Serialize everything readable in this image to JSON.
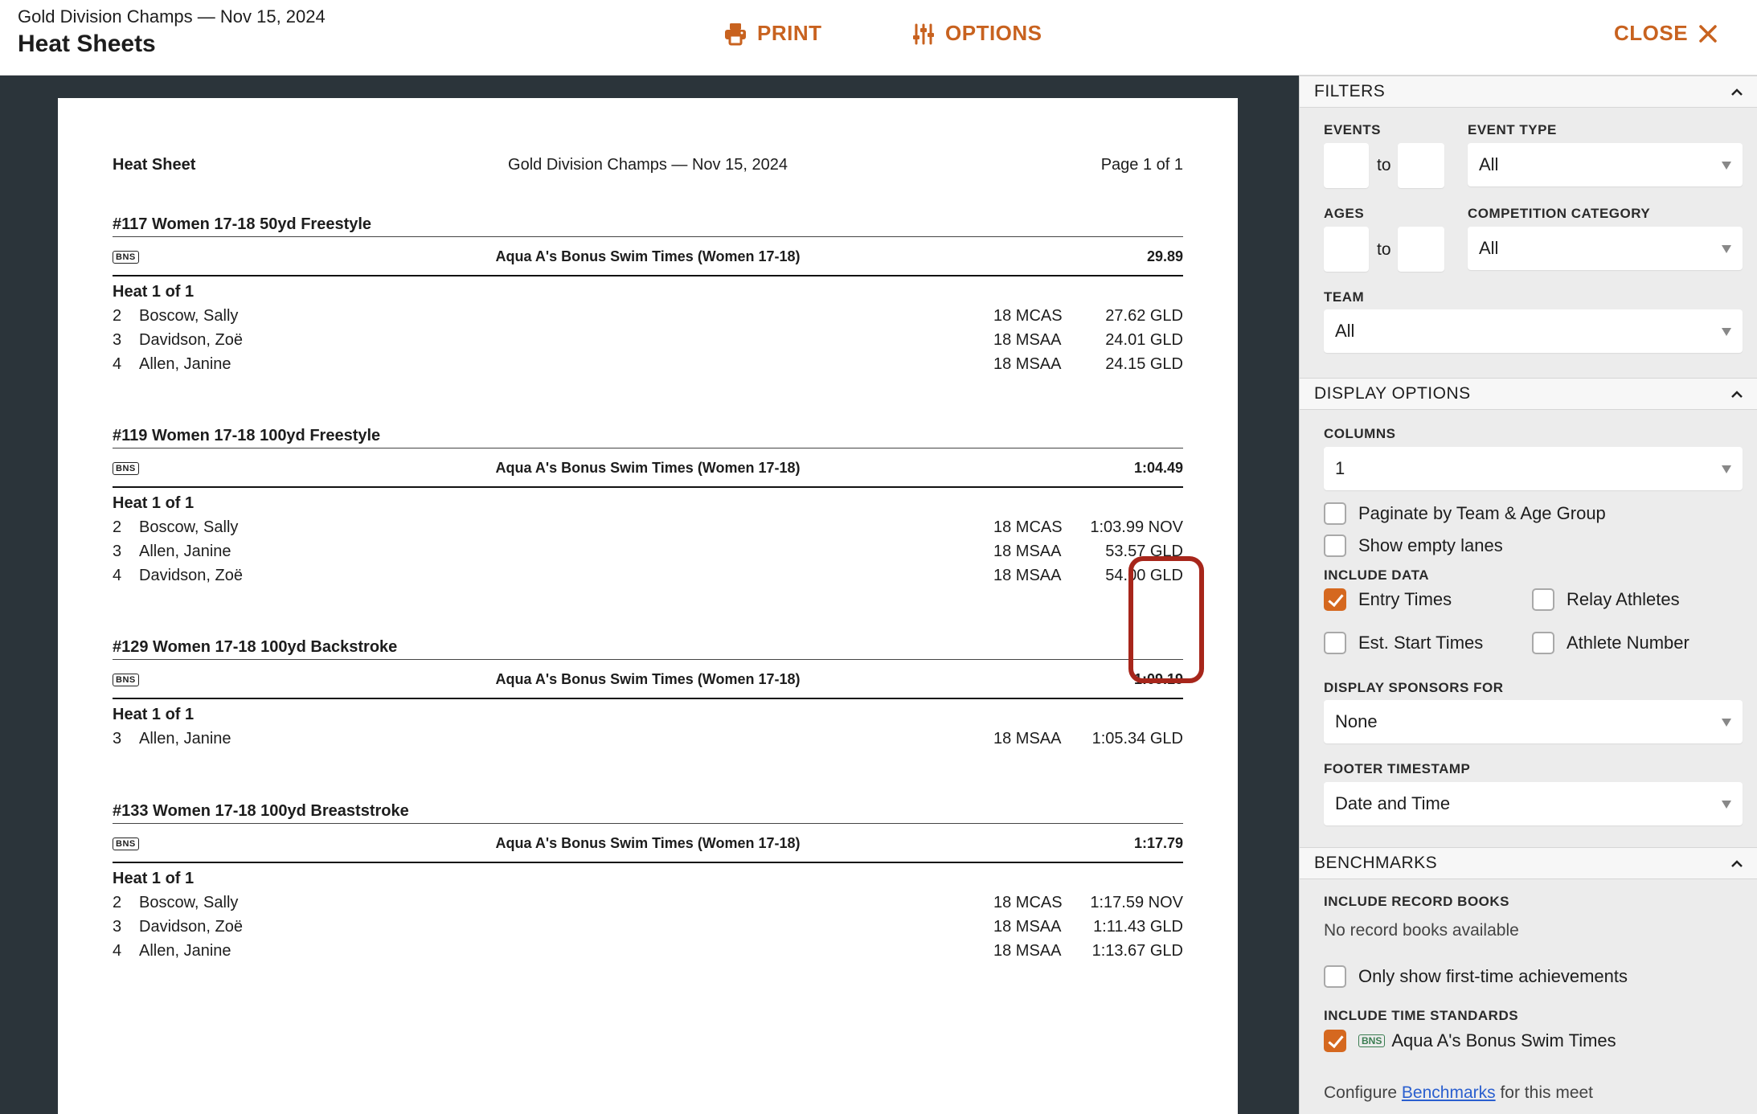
{
  "header": {
    "meet_name": "Gold Division Champs — Nov 15, 2024",
    "title": "Heat Sheets",
    "print_label": "PRINT",
    "options_label": "OPTIONS",
    "close_label": "CLOSE"
  },
  "doc": {
    "heading_left": "Heat Sheet",
    "heading_center": "Gold Division Champs — Nov 15, 2024",
    "heading_right": "Page 1 of 1",
    "events": [
      {
        "title": "#117 Women 17-18 50yd Freestyle",
        "badge": "BNS",
        "standard": "Aqua A's Bonus Swim Times (Women 17-18)",
        "standard_time": "29.89",
        "heat": "Heat 1 of 1",
        "rows": [
          {
            "lane": "2",
            "name": "Boscow, Sally",
            "team": "18 MCAS",
            "time": "27.62 GLD"
          },
          {
            "lane": "3",
            "name": "Davidson, Zoë",
            "team": "18 MSAA",
            "time": "24.01 GLD"
          },
          {
            "lane": "4",
            "name": "Allen, Janine",
            "team": "18 MSAA",
            "time": "24.15 GLD"
          }
        ]
      },
      {
        "title": "#119 Women 17-18 100yd Freestyle",
        "badge": "BNS",
        "standard": "Aqua A's Bonus Swim Times (Women 17-18)",
        "standard_time": "1:04.49",
        "heat": "Heat 1 of 1",
        "rows": [
          {
            "lane": "2",
            "name": "Boscow, Sally",
            "team": "18 MCAS",
            "time": "1:03.99 NOV"
          },
          {
            "lane": "3",
            "name": "Allen, Janine",
            "team": "18 MSAA",
            "time": "53.57 GLD"
          },
          {
            "lane": "4",
            "name": "Davidson, Zoë",
            "team": "18 MSAA",
            "time": "54.00 GLD"
          }
        ]
      },
      {
        "title": "#129 Women 17-18 100yd Backstroke",
        "badge": "BNS",
        "standard": "Aqua A's Bonus Swim Times (Women 17-18)",
        "standard_time": "1:09.19",
        "heat": "Heat 1 of 1",
        "rows": [
          {
            "lane": "3",
            "name": "Allen, Janine",
            "team": "18 MSAA",
            "time": "1:05.34 GLD"
          }
        ]
      },
      {
        "title": "#133 Women 17-18 100yd Breaststroke",
        "badge": "BNS",
        "standard": "Aqua A's Bonus Swim Times (Women 17-18)",
        "standard_time": "1:17.79",
        "heat": "Heat 1 of 1",
        "rows": [
          {
            "lane": "2",
            "name": "Boscow, Sally",
            "team": "18 MCAS",
            "time": "1:17.59 NOV"
          },
          {
            "lane": "3",
            "name": "Davidson, Zoë",
            "team": "18 MSAA",
            "time": "1:11.43 GLD"
          },
          {
            "lane": "4",
            "name": "Allen, Janine",
            "team": "18 MSAA",
            "time": "1:13.67 GLD"
          }
        ]
      }
    ]
  },
  "sidebar": {
    "filters": {
      "title": "FILTERS",
      "events_label": "EVENTS",
      "to": "to",
      "event_type_label": "EVENT TYPE",
      "event_type_value": "All",
      "ages_label": "AGES",
      "competition_category_label": "COMPETITION CATEGORY",
      "competition_category_value": "All",
      "team_label": "TEAM",
      "team_value": "All"
    },
    "display": {
      "title": "DISPLAY OPTIONS",
      "columns_label": "COLUMNS",
      "columns_value": "1",
      "paginate_label": "Paginate by Team & Age Group",
      "empty_lanes_label": "Show empty lanes",
      "include_data_label": "INCLUDE DATA",
      "entry_times_label": "Entry Times",
      "relay_athletes_label": "Relay Athletes",
      "est_start_label": "Est. Start Times",
      "athlete_number_label": "Athlete Number",
      "sponsors_label": "DISPLAY SPONSORS FOR",
      "sponsors_value": "None",
      "footer_label": "FOOTER TIMESTAMP",
      "footer_value": "Date and Time"
    },
    "benchmarks": {
      "title": "BENCHMARKS",
      "record_books_label": "INCLUDE RECORD BOOKS",
      "record_books_none": "No record books available",
      "first_time_label": "Only show first-time achievements",
      "time_standards_label": "INCLUDE TIME STANDARDS",
      "standard_badge": "BNS",
      "standard_name": "Aqua A's Bonus Swim Times",
      "configure_prefix": "Configure",
      "configure_link": "Benchmarks",
      "configure_suffix": "for this meet"
    }
  },
  "colors": {
    "accent": "#c8621f",
    "preview_bg": "#2b343a",
    "highlight": "#a7261b",
    "checked": "#d5681f"
  }
}
